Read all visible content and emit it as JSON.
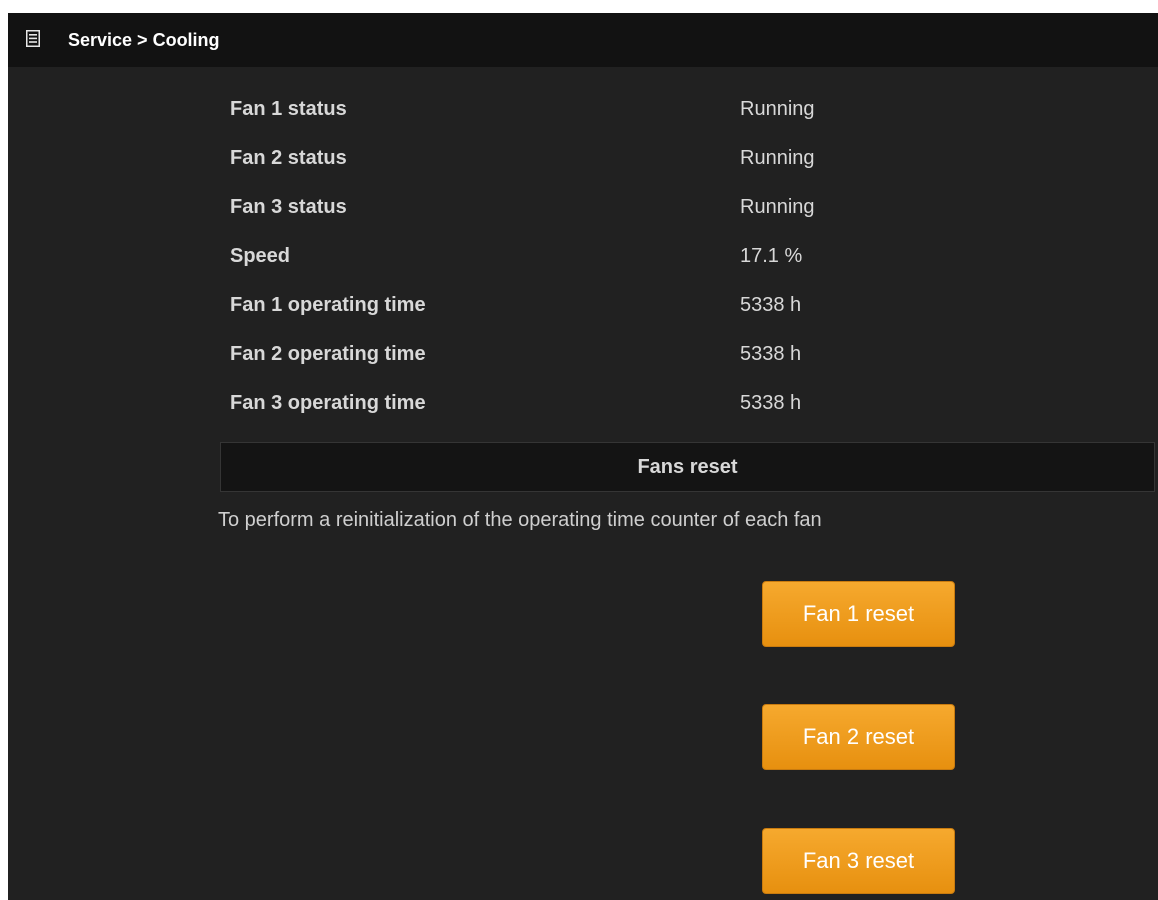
{
  "header": {
    "icon": "list-icon",
    "title": "Service > Cooling"
  },
  "status_rows": [
    {
      "label": "Fan 1 status",
      "value": "Running"
    },
    {
      "label": "Fan 2 status",
      "value": "Running"
    },
    {
      "label": "Fan 3 status",
      "value": "Running"
    },
    {
      "label": "Speed",
      "value": "17.1 %"
    },
    {
      "label": "Fan 1 operating time",
      "value": "5338 h"
    },
    {
      "label": "Fan 2 operating time",
      "value": "5338 h"
    },
    {
      "label": "Fan 3 operating time",
      "value": "5338 h"
    }
  ],
  "fans_reset": {
    "heading": "Fans reset",
    "description": "To perform a reinitialization of the operating time counter of each fan",
    "buttons": [
      {
        "label": "Fan 1 reset"
      },
      {
        "label": "Fan 2 reset"
      },
      {
        "label": "Fan 3 reset"
      }
    ]
  },
  "colors": {
    "background": "#212121",
    "header_background": "#121212",
    "button_accent": "#f0a020",
    "text": "#d8d8d8"
  }
}
